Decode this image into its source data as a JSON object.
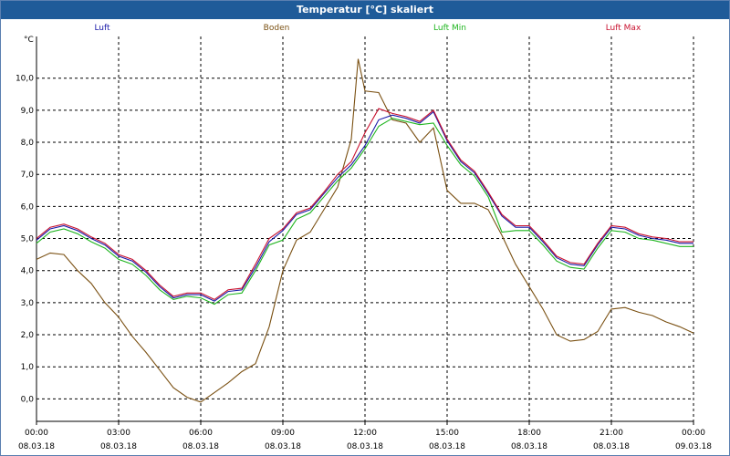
{
  "window": {
    "title": "Temperatur [°C] skaliert"
  },
  "chart_data": {
    "type": "line",
    "title": "Temperatur [°C] skaliert",
    "ylabel": "°C",
    "ylim": [
      -0.7,
      11.3
    ],
    "xlim": [
      0,
      24
    ],
    "grid": true,
    "legend_position": "top",
    "y_ticks": [
      0.0,
      1.0,
      2.0,
      3.0,
      4.0,
      5.0,
      6.0,
      7.0,
      8.0,
      9.0,
      10.0
    ],
    "y_tick_labels": [
      "0,0",
      "1,0",
      "2,0",
      "3,0",
      "4,0",
      "5,0",
      "6,0",
      "7,0",
      "8,0",
      "9,0",
      "10,0"
    ],
    "x_ticks": [
      0,
      3,
      6,
      9,
      12,
      15,
      18,
      21,
      24
    ],
    "x_tick_labels": [
      {
        "time": "00:00",
        "date": "08.03.18"
      },
      {
        "time": "03:00",
        "date": "08.03.18"
      },
      {
        "time": "06:00",
        "date": "08.03.18"
      },
      {
        "time": "09:00",
        "date": "08.03.18"
      },
      {
        "time": "12:00",
        "date": "08.03.18"
      },
      {
        "time": "15:00",
        "date": "08.03.18"
      },
      {
        "time": "18:00",
        "date": "08.03.18"
      },
      {
        "time": "21:00",
        "date": "08.03.18"
      },
      {
        "time": "00:00",
        "date": "09.03.18"
      }
    ],
    "x_unit": "hours since 08.03.18 00:00",
    "series": [
      {
        "name": "Luft",
        "color": "#1a1aa8",
        "points": [
          [
            0,
            4.95
          ],
          [
            0.5,
            5.3
          ],
          [
            1,
            5.4
          ],
          [
            1.5,
            5.25
          ],
          [
            2,
            5.0
          ],
          [
            2.5,
            4.8
          ],
          [
            3,
            4.45
          ],
          [
            3.5,
            4.3
          ],
          [
            4,
            3.95
          ],
          [
            4.5,
            3.5
          ],
          [
            5,
            3.15
          ],
          [
            5.5,
            3.25
          ],
          [
            6,
            3.25
          ],
          [
            6.5,
            3.05
          ],
          [
            7,
            3.35
          ],
          [
            7.5,
            3.4
          ],
          [
            8,
            4.1
          ],
          [
            8.5,
            4.9
          ],
          [
            9,
            5.25
          ],
          [
            9.5,
            5.75
          ],
          [
            10,
            5.9
          ],
          [
            10.5,
            6.4
          ],
          [
            11,
            6.9
          ],
          [
            11.5,
            7.3
          ],
          [
            12,
            7.9
          ],
          [
            12.5,
            8.7
          ],
          [
            13,
            8.85
          ],
          [
            13.5,
            8.75
          ],
          [
            14,
            8.6
          ],
          [
            14.5,
            8.95
          ],
          [
            15,
            8.05
          ],
          [
            15.5,
            7.4
          ],
          [
            16,
            7.05
          ],
          [
            16.5,
            6.4
          ],
          [
            17,
            5.7
          ],
          [
            17.5,
            5.35
          ],
          [
            18,
            5.35
          ],
          [
            18.5,
            4.9
          ],
          [
            19,
            4.4
          ],
          [
            19.5,
            4.2
          ],
          [
            20,
            4.15
          ],
          [
            20.5,
            4.8
          ],
          [
            21,
            5.35
          ],
          [
            21.5,
            5.3
          ],
          [
            22,
            5.1
          ],
          [
            22.5,
            5.0
          ],
          [
            23,
            4.95
          ],
          [
            23.5,
            4.85
          ],
          [
            24,
            4.85
          ]
        ]
      },
      {
        "name": "Boden",
        "color": "#7a5012",
        "points": [
          [
            0,
            4.35
          ],
          [
            0.5,
            4.55
          ],
          [
            1,
            4.5
          ],
          [
            1.5,
            4.0
          ],
          [
            2,
            3.6
          ],
          [
            2.5,
            3.0
          ],
          [
            3,
            2.55
          ],
          [
            3.5,
            1.95
          ],
          [
            4,
            1.45
          ],
          [
            4.5,
            0.9
          ],
          [
            5,
            0.35
          ],
          [
            5.5,
            0.05
          ],
          [
            6,
            -0.1
          ],
          [
            6.5,
            0.2
          ],
          [
            7,
            0.5
          ],
          [
            7.5,
            0.85
          ],
          [
            8,
            1.1
          ],
          [
            8.5,
            2.25
          ],
          [
            9,
            4.0
          ],
          [
            9.5,
            4.95
          ],
          [
            10,
            5.2
          ],
          [
            10.5,
            5.9
          ],
          [
            11,
            6.6
          ],
          [
            11.5,
            8.1
          ],
          [
            11.75,
            10.6
          ],
          [
            12,
            9.6
          ],
          [
            12.5,
            9.55
          ],
          [
            13,
            8.7
          ],
          [
            13.5,
            8.6
          ],
          [
            14,
            8.0
          ],
          [
            14.5,
            8.45
          ],
          [
            15,
            6.5
          ],
          [
            15.5,
            6.1
          ],
          [
            16,
            6.1
          ],
          [
            16.5,
            5.9
          ],
          [
            17,
            5.1
          ],
          [
            17.5,
            4.2
          ],
          [
            18,
            3.5
          ],
          [
            18.5,
            2.8
          ],
          [
            19,
            2.0
          ],
          [
            19.5,
            1.8
          ],
          [
            20,
            1.85
          ],
          [
            20.5,
            2.1
          ],
          [
            21,
            2.8
          ],
          [
            21.5,
            2.85
          ],
          [
            22,
            2.7
          ],
          [
            22.5,
            2.6
          ],
          [
            23,
            2.4
          ],
          [
            23.5,
            2.25
          ],
          [
            24,
            2.05
          ]
        ]
      },
      {
        "name": "Luft Min",
        "color": "#1fb51f",
        "points": [
          [
            0,
            4.85
          ],
          [
            0.5,
            5.2
          ],
          [
            1,
            5.3
          ],
          [
            1.5,
            5.15
          ],
          [
            2,
            4.9
          ],
          [
            2.5,
            4.7
          ],
          [
            3,
            4.35
          ],
          [
            3.5,
            4.2
          ],
          [
            4,
            3.85
          ],
          [
            4.5,
            3.4
          ],
          [
            5,
            3.1
          ],
          [
            5.5,
            3.2
          ],
          [
            6,
            3.15
          ],
          [
            6.5,
            2.95
          ],
          [
            7,
            3.25
          ],
          [
            7.5,
            3.3
          ],
          [
            8,
            4.0
          ],
          [
            8.5,
            4.8
          ],
          [
            9,
            4.95
          ],
          [
            9.5,
            5.6
          ],
          [
            10,
            5.8
          ],
          [
            10.5,
            6.3
          ],
          [
            11,
            6.8
          ],
          [
            11.5,
            7.2
          ],
          [
            12,
            7.8
          ],
          [
            12.5,
            8.5
          ],
          [
            13,
            8.75
          ],
          [
            13.5,
            8.65
          ],
          [
            14,
            8.55
          ],
          [
            14.5,
            8.6
          ],
          [
            15,
            7.9
          ],
          [
            15.5,
            7.3
          ],
          [
            16,
            6.95
          ],
          [
            16.5,
            6.3
          ],
          [
            17,
            5.2
          ],
          [
            17.5,
            5.25
          ],
          [
            18,
            5.25
          ],
          [
            18.5,
            4.8
          ],
          [
            19,
            4.3
          ],
          [
            19.5,
            4.1
          ],
          [
            20,
            4.05
          ],
          [
            20.5,
            4.7
          ],
          [
            21,
            5.25
          ],
          [
            21.5,
            5.2
          ],
          [
            22,
            5.0
          ],
          [
            22.5,
            4.95
          ],
          [
            23,
            4.85
          ],
          [
            23.5,
            4.75
          ],
          [
            24,
            4.75
          ]
        ]
      },
      {
        "name": "Luft Max",
        "color": "#c8102e",
        "points": [
          [
            0,
            5.0
          ],
          [
            0.5,
            5.35
          ],
          [
            1,
            5.45
          ],
          [
            1.5,
            5.3
          ],
          [
            2,
            5.05
          ],
          [
            2.5,
            4.85
          ],
          [
            3,
            4.5
          ],
          [
            3.5,
            4.35
          ],
          [
            4,
            4.0
          ],
          [
            4.5,
            3.55
          ],
          [
            5,
            3.2
          ],
          [
            5.5,
            3.3
          ],
          [
            6,
            3.3
          ],
          [
            6.5,
            3.1
          ],
          [
            7,
            3.4
          ],
          [
            7.5,
            3.45
          ],
          [
            8,
            4.2
          ],
          [
            8.5,
            5.0
          ],
          [
            9,
            5.3
          ],
          [
            9.5,
            5.8
          ],
          [
            10,
            5.95
          ],
          [
            10.5,
            6.45
          ],
          [
            11,
            7.0
          ],
          [
            11.5,
            7.4
          ],
          [
            12,
            8.3
          ],
          [
            12.5,
            9.05
          ],
          [
            13,
            8.9
          ],
          [
            13.5,
            8.8
          ],
          [
            14,
            8.65
          ],
          [
            14.5,
            9.0
          ],
          [
            15,
            8.1
          ],
          [
            15.5,
            7.45
          ],
          [
            16,
            7.1
          ],
          [
            16.5,
            6.45
          ],
          [
            17,
            5.75
          ],
          [
            17.5,
            5.4
          ],
          [
            18,
            5.4
          ],
          [
            18.5,
            4.95
          ],
          [
            19,
            4.45
          ],
          [
            19.5,
            4.25
          ],
          [
            20,
            4.2
          ],
          [
            20.5,
            4.85
          ],
          [
            21,
            5.4
          ],
          [
            21.5,
            5.35
          ],
          [
            22,
            5.15
          ],
          [
            22.5,
            5.05
          ],
          [
            23,
            5.0
          ],
          [
            23.5,
            4.9
          ],
          [
            24,
            4.9
          ]
        ]
      }
    ]
  }
}
